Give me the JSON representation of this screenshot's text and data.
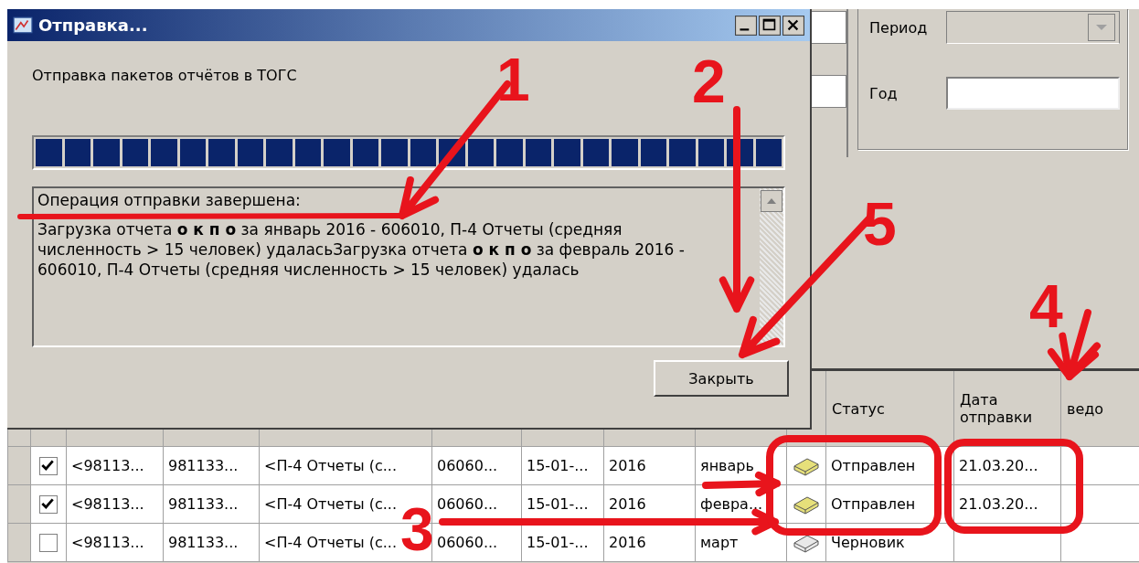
{
  "dialog": {
    "title": "Отправка...",
    "caption": "Отправка пакетов отчётов в ТОГС",
    "progress": {
      "level": 1
    },
    "log": {
      "heading": "Операция отправки завершена:",
      "body": "Загрузка отчета **о к п о** за январь 2016 - 606010, П-4 Отчеты  (средняя численность > 15 человек) удаласьЗагрузка отчета **о к п о** за февраль 2016 - 606010, П-4 Отчеты  (средняя численность > 15 человек) удалась"
    },
    "close_button": "Закрыть"
  },
  "filters": {
    "period_label": "Период",
    "year_label": "Год"
  },
  "table": {
    "headers": {
      "status": "Статус",
      "sent_date": "Дата отправки",
      "column_13": "ведо"
    },
    "rows": [
      {
        "checked": true,
        "cells": [
          "<98113...",
          "981133...",
          "<П-4 Отчеты  (с...",
          "06060...",
          "15-01-...",
          "2016",
          "январь"
        ],
        "sent": true,
        "status": "Отправлен",
        "sent_date": "21.03.20..."
      },
      {
        "checked": true,
        "cells": [
          "<98113...",
          "981133...",
          "<П-4 Отчеты  (с...",
          "06060...",
          "15-01-...",
          "2016",
          "февра..."
        ],
        "sent": true,
        "status": "Отправлен",
        "sent_date": "21.03.20..."
      },
      {
        "checked": false,
        "cells": [
          "<98113...",
          "981133...",
          "<П-4 Отчеты  (с...",
          "06060...",
          "15-01-...",
          "2016",
          "март"
        ],
        "sent": false,
        "status": "Черновик"
      }
    ]
  },
  "annotations": [
    {
      "label": "1"
    },
    {
      "label": "2"
    },
    {
      "label": "3"
    },
    {
      "label": "4"
    },
    {
      "label": "5"
    }
  ]
}
